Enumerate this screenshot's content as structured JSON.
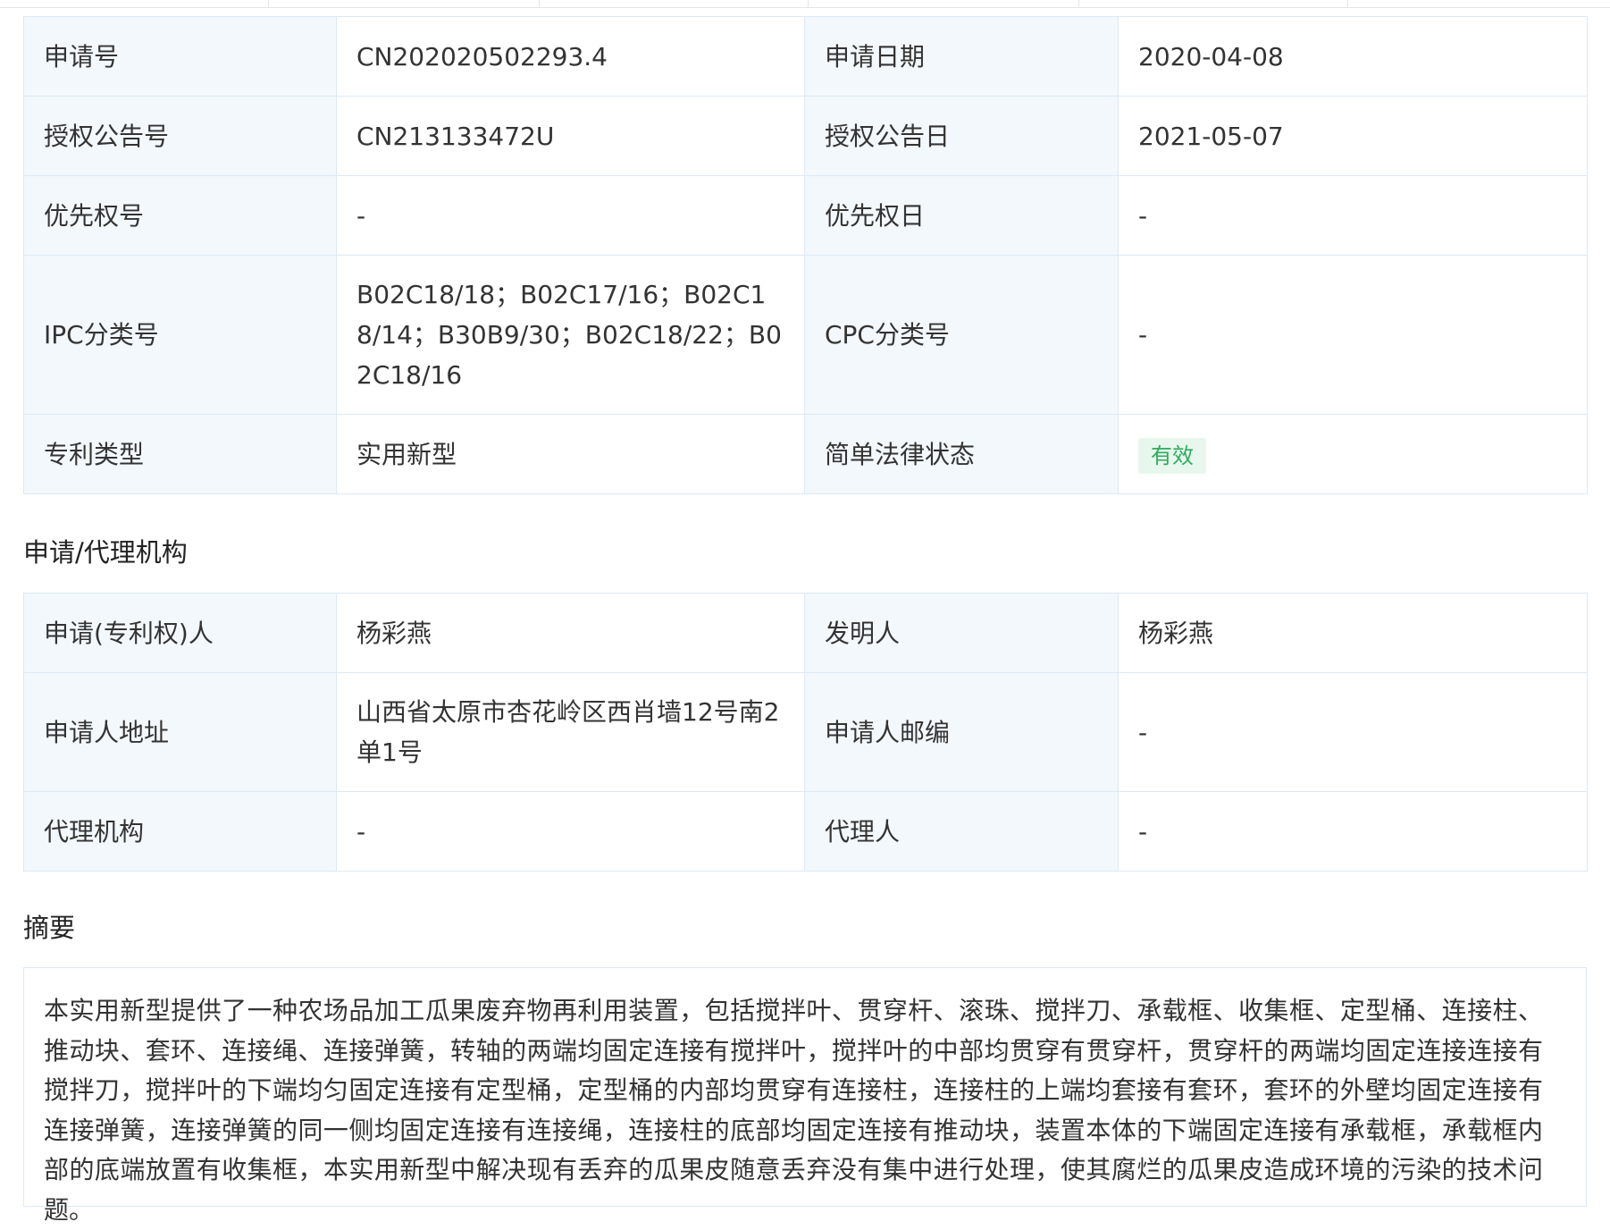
{
  "basic_info": {
    "application_no": {
      "label": "申请号",
      "value": "CN202020502293.4"
    },
    "application_date": {
      "label": "申请日期",
      "value": "2020-04-08"
    },
    "grant_pub_no": {
      "label": "授权公告号",
      "value": "CN213133472U"
    },
    "grant_pub_date": {
      "label": "授权公告日",
      "value": "2021-05-07"
    },
    "priority_no": {
      "label": "优先权号",
      "value": "-"
    },
    "priority_date": {
      "label": "优先权日",
      "value": "-"
    },
    "ipc": {
      "label": "IPC分类号",
      "value": "B02C18/18；B02C17/16；B02C18/14；B30B9/30；B02C18/22；B02C18/16"
    },
    "cpc": {
      "label": "CPC分类号",
      "value": "-"
    },
    "patent_type": {
      "label": "专利类型",
      "value": "实用新型"
    },
    "legal_status": {
      "label": "简单法律状态",
      "value": "有效",
      "badge_color": "#2dac5c"
    }
  },
  "agency": {
    "title": "申请/代理机构",
    "applicant": {
      "label": "申请(专利权)人",
      "value": "杨彩燕"
    },
    "inventor": {
      "label": "发明人",
      "value": "杨彩燕"
    },
    "address": {
      "label": "申请人地址",
      "value": "山西省太原市杏花岭区西肖墙12号南2单1号"
    },
    "postcode": {
      "label": "申请人邮编",
      "value": "-"
    },
    "agency_org": {
      "label": "代理机构",
      "value": "-"
    },
    "agent": {
      "label": "代理人",
      "value": "-"
    }
  },
  "abstract": {
    "title": "摘要",
    "text": "本实用新型提供了一种农场品加工瓜果废弃物再利用装置，包括搅拌叶、贯穿杆、滚珠、搅拌刀、承载框、收集框、定型桶、连接柱、推动块、套环、连接绳、连接弹簧，转轴的两端均固定连接有搅拌叶，搅拌叶的中部均贯穿有贯穿杆，贯穿杆的两端均固定连接连接有搅拌刀，搅拌叶的下端均匀固定连接有定型桶，定型桶的内部均贯穿有连接柱，连接柱的上端均套接有套环，套环的外壁均固定连接有连接弹簧，连接弹簧的同一侧均固定连接有连接绳，连接柱的底部均固定连接有推动块，装置本体的下端固定连接有承载框，承载框内部的底端放置有收集框，本实用新型中解决现有丢弃的瓜果皮随意丢弃没有集中进行处理，使其腐烂的瓜果皮造成环境的污染的技术问题。"
  }
}
